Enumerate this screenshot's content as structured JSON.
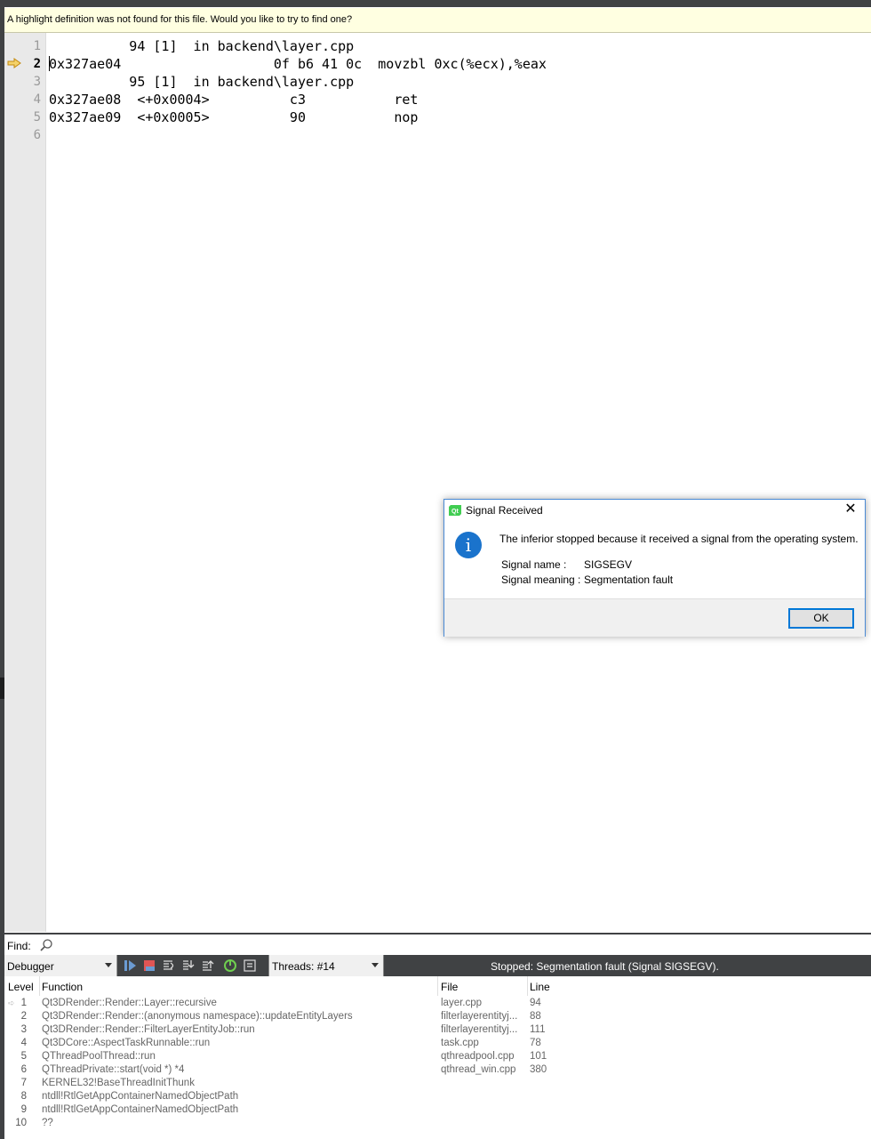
{
  "infobar": {
    "message": "A highlight definition was not found for this file. Would you like to try to find one?"
  },
  "editor": {
    "lines": [
      {
        "number": "1",
        "text": "          94 [1]  in backend\\layer.cpp"
      },
      {
        "number": "2",
        "text": "0x327ae04                   0f b6 41 0c  movzbl 0xc(%ecx),%eax"
      },
      {
        "number": "3",
        "text": "          95 [1]  in backend\\layer.cpp"
      },
      {
        "number": "4",
        "text": "0x327ae08  <+0x0004>          c3           ret"
      },
      {
        "number": "5",
        "text": "0x327ae09  <+0x0005>          90           nop"
      },
      {
        "number": "6",
        "text": ""
      }
    ],
    "current_line": "2",
    "arrow_icon": "current-location-arrow-icon",
    "arrow_color": "#e8b22a"
  },
  "dialog": {
    "title": "Signal Received",
    "app_icon": "qt-creator-icon",
    "close_icon": "close-icon",
    "info_icon": "info-icon",
    "message": "The inferior stopped because it received a signal from the operating system.",
    "signal_name_label": "Signal name :",
    "signal_name": "SIGSEGV",
    "signal_meaning_label": "Signal meaning :",
    "signal_meaning": "Segmentation fault",
    "ok_label": "OK",
    "accent": "#0078d7"
  },
  "findbar": {
    "label": "Find:",
    "icon": "search-icon"
  },
  "debugger_toolbar": {
    "selector_value": "Debugger",
    "threads_value": "Threads: #14",
    "status": "Stopped: Segmentation fault (Signal SIGSEGV).",
    "icons": [
      "continue-icon",
      "interrupt-stop-icon",
      "step-over-icon",
      "step-into-icon",
      "step-out-icon",
      "restart-icon",
      "reset-icon"
    ]
  },
  "stack": {
    "headers": {
      "level": "Level",
      "function": "Function",
      "file": "File",
      "line": "Line"
    },
    "rows": [
      {
        "level": "1",
        "function": "Qt3DRender::Render::Layer::recursive",
        "file": "layer.cpp",
        "line": "94"
      },
      {
        "level": "2",
        "function": "Qt3DRender::Render::(anonymous namespace)::updateEntityLayers",
        "file": "filterlayerentityj...",
        "line": "88"
      },
      {
        "level": "3",
        "function": "Qt3DRender::Render::FilterLayerEntityJob::run",
        "file": "filterlayerentityj...",
        "line": "111"
      },
      {
        "level": "4",
        "function": "Qt3DCore::AspectTaskRunnable::run",
        "file": "task.cpp",
        "line": "78"
      },
      {
        "level": "5",
        "function": "QThreadPoolThread::run",
        "file": "qthreadpool.cpp",
        "line": "101"
      },
      {
        "level": "6",
        "function": "QThreadPrivate::start(void *) *4",
        "file": "qthread_win.cpp",
        "line": "380"
      },
      {
        "level": "7",
        "function": "KERNEL32!BaseThreadInitThunk",
        "file": "",
        "line": ""
      },
      {
        "level": "8",
        "function": "ntdll!RtlGetAppContainerNamedObjectPath",
        "file": "",
        "line": ""
      },
      {
        "level": "9",
        "function": "ntdll!RtlGetAppContainerNamedObjectPath",
        "file": "",
        "line": ""
      },
      {
        "level": "10",
        "function": "??",
        "file": "",
        "line": ""
      }
    ]
  }
}
